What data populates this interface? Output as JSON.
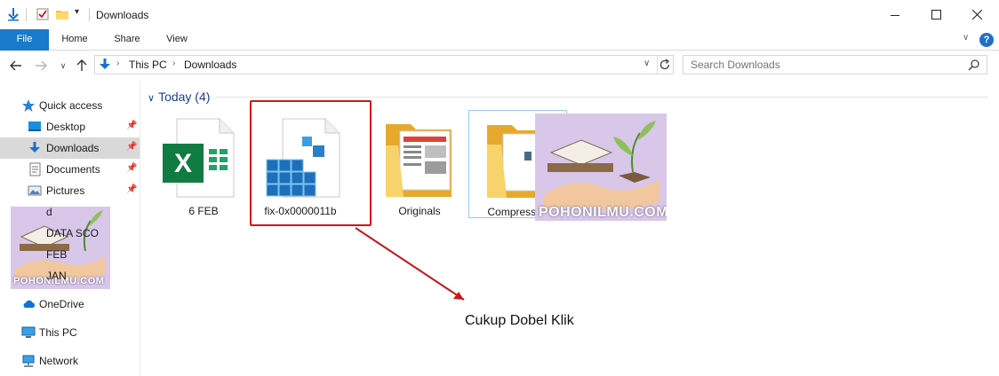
{
  "window": {
    "title": "Downloads",
    "controls": [
      "minimize",
      "maximize",
      "close"
    ]
  },
  "ribbon": {
    "tabs": [
      "File",
      "Home",
      "Share",
      "View"
    ],
    "help_label": "?"
  },
  "address_bar": {
    "path": [
      "This PC",
      "Downloads"
    ],
    "search_placeholder": "Search Downloads"
  },
  "nav_pane": {
    "quick_access": "Quick access",
    "items": [
      {
        "label": "Desktop",
        "icon": "desktop-icon",
        "pinned": true
      },
      {
        "label": "Downloads",
        "icon": "download-icon",
        "pinned": true,
        "selected": true
      },
      {
        "label": "Documents",
        "icon": "documents-icon",
        "pinned": true
      },
      {
        "label": "Pictures",
        "icon": "pictures-icon",
        "pinned": true
      },
      {
        "label": "d",
        "icon": "folder-icon"
      },
      {
        "label": "DATA SCO",
        "icon": "folder-icon"
      },
      {
        "label": "FEB",
        "icon": "folder-icon"
      },
      {
        "label": "JAN",
        "icon": "folder-icon"
      }
    ],
    "onedrive": "OneDrive",
    "this_pc": "This PC",
    "network": "Network"
  },
  "content": {
    "group_header": "Today (4)",
    "files": [
      {
        "name": "6 FEB",
        "type": "excel-file-icon"
      },
      {
        "name": "fix-0x0000011b",
        "type": "registry-file-icon"
      },
      {
        "name": "Originals",
        "type": "folder-icon"
      },
      {
        "name": "Compressed",
        "type": "folder-icon"
      }
    ]
  },
  "annotation": {
    "text": "Cukup Dobel Klik",
    "color": "#c9171c"
  },
  "watermark": {
    "text": "POHONILMU.COM"
  },
  "colors": {
    "accent": "#1979ca",
    "selection": "#d9d9d9",
    "group_header": "#1e3d8f"
  }
}
